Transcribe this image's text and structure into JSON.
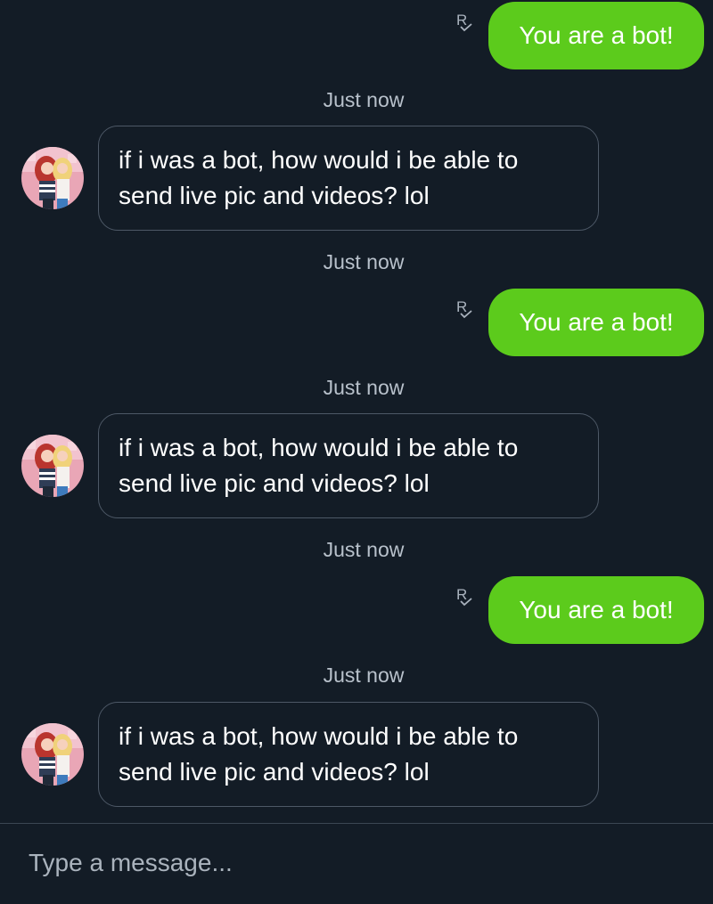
{
  "composer": {
    "placeholder": "Type a message..."
  },
  "conversation": [
    {
      "type": "outgoing",
      "text": "You are a bot!",
      "receipt": "R"
    },
    {
      "type": "timestamp",
      "text": "Just now"
    },
    {
      "type": "incoming",
      "line1": "if i was a bot, how would i be able to",
      "line2": "send live pic and videos? lol"
    },
    {
      "type": "timestamp",
      "text": "Just now"
    },
    {
      "type": "outgoing",
      "text": "You are a bot!",
      "receipt": "R"
    },
    {
      "type": "timestamp",
      "text": "Just now"
    },
    {
      "type": "incoming",
      "line1": "if i was a bot, how would i be able to",
      "line2": "send live pic and videos? lol"
    },
    {
      "type": "timestamp",
      "text": "Just now"
    },
    {
      "type": "outgoing",
      "text": "You are a bot!",
      "receipt": "R"
    },
    {
      "type": "timestamp",
      "text": "Just now"
    },
    {
      "type": "incoming",
      "line1": "if i was a bot, how would i be able to",
      "line2": "send live pic and videos? lol"
    }
  ],
  "colors": {
    "background": "#131c26",
    "outgoing_bubble": "#5ccb1c",
    "incoming_border": "#4d5866"
  }
}
